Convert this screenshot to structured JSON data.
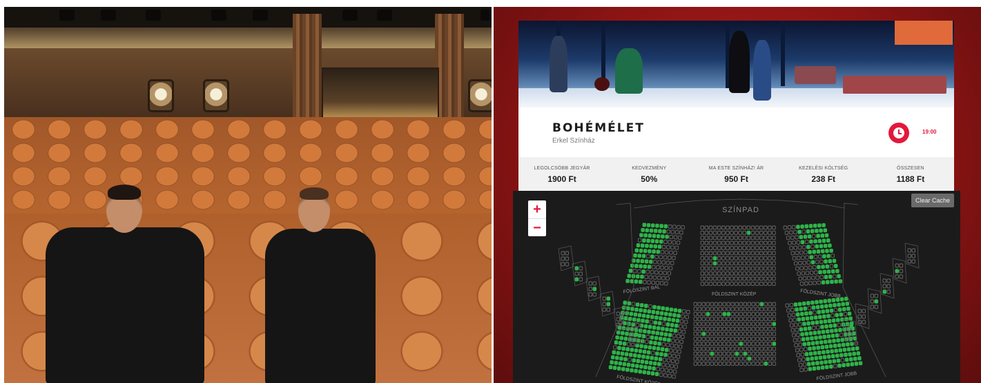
{
  "event": {
    "title": "BOHÉMÉLET",
    "venue": "Erkel Színház",
    "time": "19:00"
  },
  "prices": [
    {
      "label": "LEGOLCSÓBB JEGYÁR",
      "value": "1900 Ft"
    },
    {
      "label": "KEDVEZMÉNY",
      "value": "50%"
    },
    {
      "label": "MA ESTE SZÍNHÁZ! ÁR",
      "value": "950 Ft"
    },
    {
      "label": "KEZELÉSI KÖLTSÉG",
      "value": "238 Ft"
    },
    {
      "label": "ÖSSZESEN",
      "value": "1188 Ft"
    }
  ],
  "map": {
    "stage_label": "SZÍNPAD",
    "zoom_in": "+",
    "zoom_out": "−",
    "clear_cache": "Clear Cache",
    "sections": {
      "left": "FÖLDSZINT BAL",
      "center": "FÖLDSZINT KÖZÉP",
      "right": "FÖLDSZINT JOBB",
      "bottom_center": "FÖLDSZINT KÖZÉP",
      "bottom_right": "FÖLDSZINT JOBB"
    }
  },
  "colors": {
    "accent": "#e4173a",
    "available_seat": "#2fb34a",
    "unavailable_seat": "#6a6a6a",
    "background": "#9c1717"
  }
}
